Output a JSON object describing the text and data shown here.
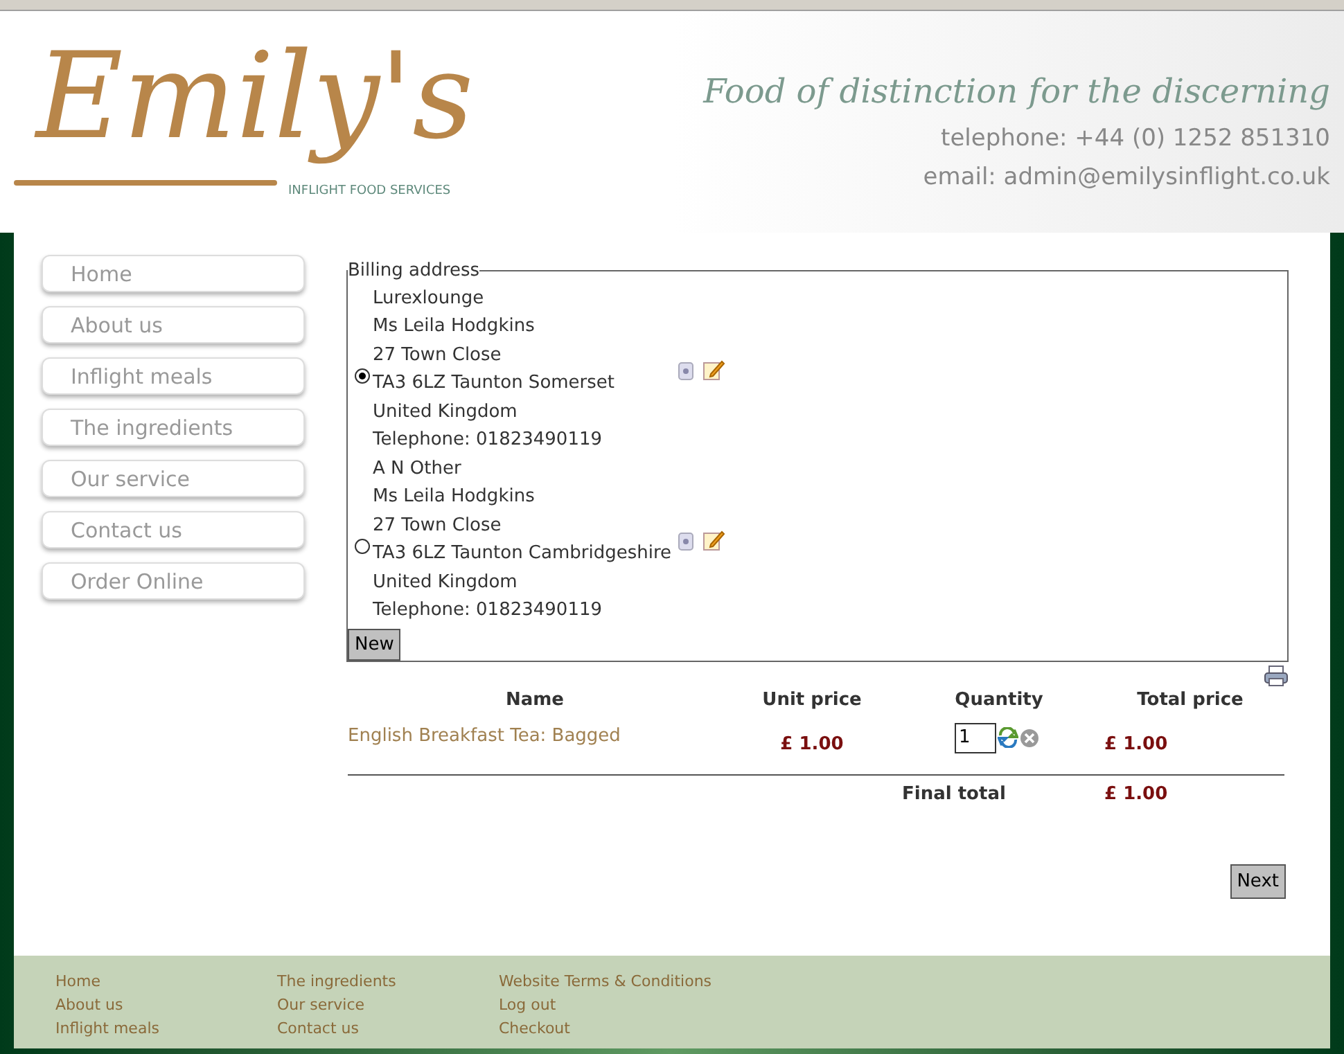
{
  "header": {
    "logo": {
      "name": "Emily's",
      "tagline": "INFLIGHT FOOD SERVICES"
    },
    "slogan": "Food of distinction for the discerning",
    "telephone": {
      "label": "telephone:",
      "value": "+44 (0) 1252 851310"
    },
    "email": {
      "label": "email:",
      "value": "admin@emilysinflight.co.uk"
    }
  },
  "nav": [
    {
      "label": "Home"
    },
    {
      "label": "About us"
    },
    {
      "label": "Inflight meals"
    },
    {
      "label": "The ingredients"
    },
    {
      "label": "Our service"
    },
    {
      "label": "Contact us"
    },
    {
      "label": "Order Online"
    }
  ],
  "billing": {
    "legend": "Billing address",
    "addresses": [
      {
        "selected": true,
        "lines": [
          "Lurexlounge",
          "Ms Leila Hodgkins",
          "27 Town Close",
          "TA3 6LZ Taunton Somerset",
          "United Kingdom",
          "Telephone: 01823490119"
        ]
      },
      {
        "selected": false,
        "lines": [
          "A N Other",
          "Ms Leila Hodgkins",
          "27 Town Close",
          "TA3 6LZ Taunton Cambridgeshire",
          "United Kingdom",
          "Telephone: 01823490119"
        ]
      }
    ],
    "new_button": "New"
  },
  "cart": {
    "columns": [
      "Name",
      "Unit price",
      "Quantity",
      "Total price"
    ],
    "rows": [
      {
        "name": "English Breakfast Tea: Bagged",
        "unit_price": "£ 1.00",
        "quantity": "1",
        "total_price": "£ 1.00"
      }
    ],
    "final_label": "Final total",
    "final_total": "£ 1.00"
  },
  "next_button": "Next",
  "footer": [
    [
      "Home",
      "About us",
      "Inflight meals"
    ],
    [
      "The ingredients",
      "Our service",
      "Contact us"
    ],
    [
      "Website Terms & Conditions",
      "Log out",
      "Checkout"
    ]
  ]
}
